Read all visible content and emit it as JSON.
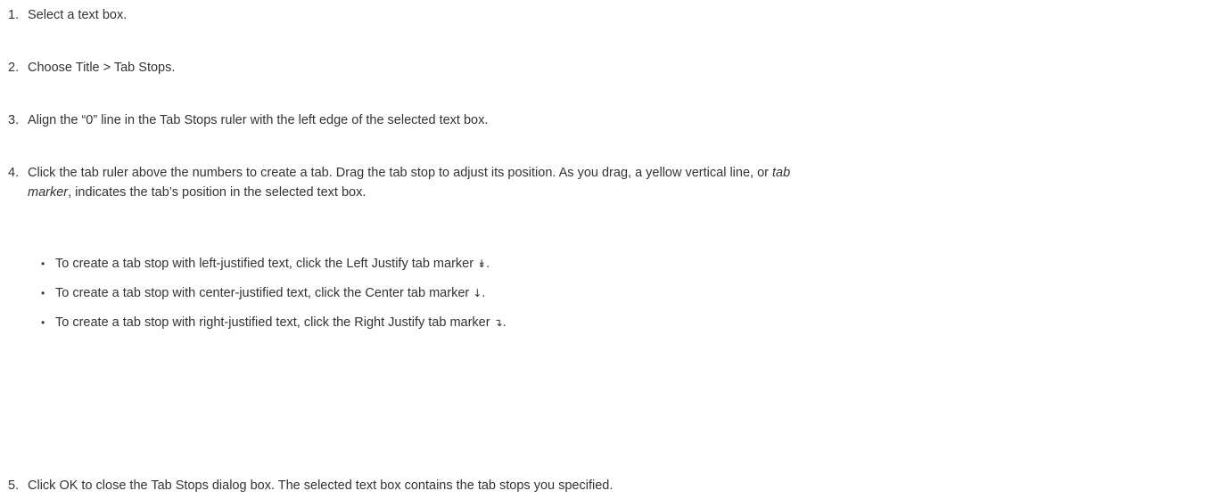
{
  "steps": [
    {
      "num": "1.",
      "text": "Select a text box."
    },
    {
      "num": "2.",
      "text": "Choose Title > Tab Stops."
    },
    {
      "num": "3.",
      "text": "Align the “0” line in the Tab Stops ruler with the left edge of the selected text box."
    },
    {
      "num": "4.",
      "text_a": "Click the tab ruler above the numbers to create a tab. Drag the tab stop to adjust its position. As you drag, a yellow vertical line, or ",
      "em1": "tab",
      "text_b": "",
      "em2": "marker",
      "text_c": ", indicates the tab’s position in the selected text box."
    },
    {
      "num": "5.",
      "text": "Click OK to close the Tab Stops dialog box. The selected text box contains the tab stops you specified."
    }
  ],
  "bullets": [
    {
      "dot": "•",
      "text": "To create a tab stop with left-justified text, click the Left Justify tab marker ",
      "icon": "left-justify-tab-marker-icon",
      "glyph": "↡",
      "end": "."
    },
    {
      "dot": "•",
      "text": "To create a tab stop with center-justified text, click the Center tab marker ",
      "icon": "center-tab-marker-icon",
      "glyph": "↓",
      "end": "."
    },
    {
      "dot": "•",
      "text": "To create a tab stop with right-justified text, click the Right Justify tab marker ",
      "icon": "right-justify-tab-marker-icon",
      "glyph": "↴",
      "end": "."
    }
  ]
}
